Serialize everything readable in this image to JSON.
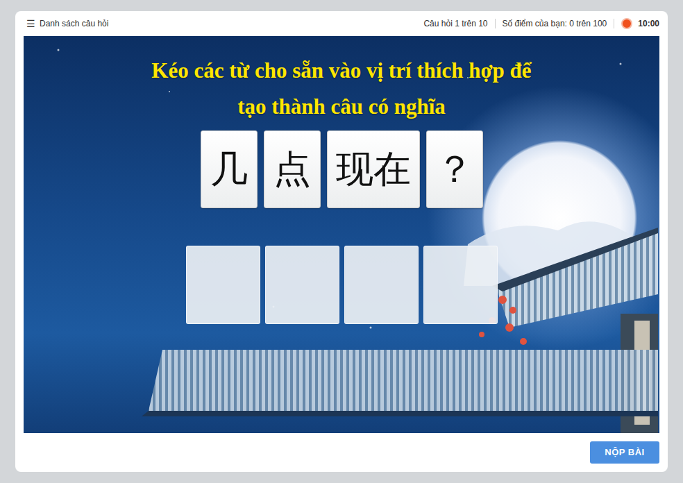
{
  "topbar": {
    "menu_icon": "☰",
    "list_label": "Danh sách câu hỏi",
    "progress": "Câu hỏi 1 trên 10",
    "score": "Số điểm của bạn: 0 trên 100",
    "timer": "10:00"
  },
  "instruction_lines": [
    "Kéo các từ cho sẵn vào vị trí thích hợp để",
    "tạo thành câu có nghĩa"
  ],
  "words": [
    {
      "text": "几"
    },
    {
      "text": "点"
    },
    {
      "text": "现在"
    },
    {
      "text": "？"
    }
  ],
  "slots": [
    {
      "filled": false
    },
    {
      "filled": false
    },
    {
      "filled": false
    },
    {
      "filled": false
    }
  ],
  "submit_button": "NỘP BÀI"
}
